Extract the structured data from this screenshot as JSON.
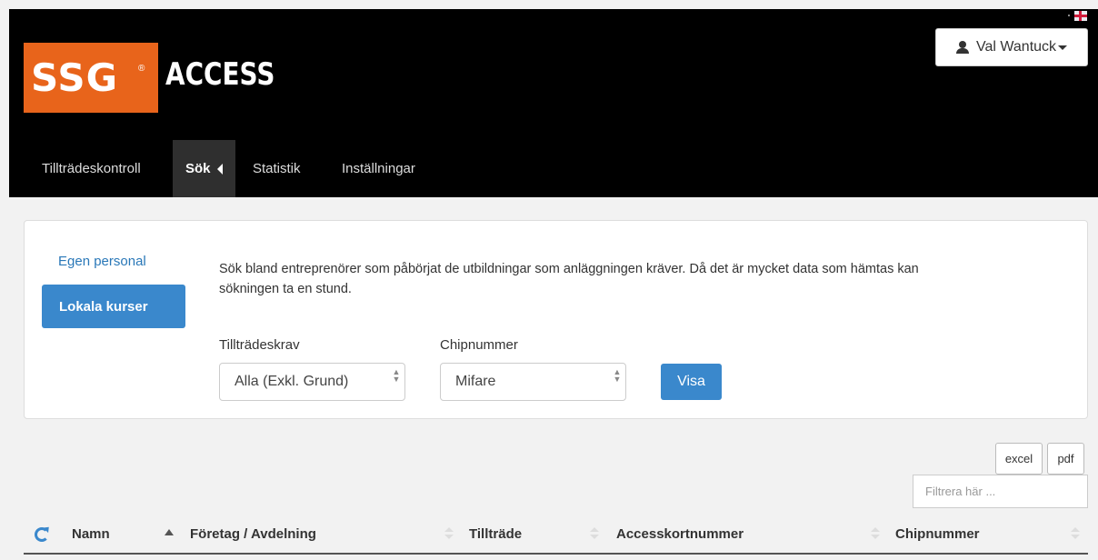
{
  "header": {
    "logo_text": "SSG",
    "logo_reg": "®",
    "app_name": "ACCESS",
    "user_name": "Val Wantuck",
    "language_icon": "uk-flag-icon"
  },
  "nav": {
    "items": [
      {
        "label": "Tillträdeskontroll"
      },
      {
        "label": "Sök",
        "active": true
      },
      {
        "label": "Statistik"
      },
      {
        "label": "Inställningar"
      }
    ]
  },
  "search_panel": {
    "sidebar": {
      "link": "Egen personal",
      "active": "Lokala kurser"
    },
    "description": "Sök bland entreprenörer som påbörjat de utbildningar som anläggningen kräver. Då det är mycket data som hämtas kan sökningen ta en stund.",
    "requirement": {
      "label": "Tillträdeskrav",
      "value": "Alla (Exkl. Grund)"
    },
    "chip": {
      "label": "Chipnummer",
      "value": "Mifare"
    },
    "submit_label": "Visa"
  },
  "export": {
    "excel": "excel",
    "pdf": "pdf"
  },
  "filter": {
    "placeholder": "Filtrera här ..."
  },
  "table": {
    "columns": [
      "Namn",
      "Företag / Avdelning",
      "Tillträde",
      "Accesskortnummer",
      "Chipnummer"
    ],
    "sorted_column": "Namn",
    "sort_direction": "ascending"
  },
  "colors": {
    "brand_orange": "#e8641b",
    "primary_blue": "#3a88cc",
    "header_bg": "#000000"
  }
}
